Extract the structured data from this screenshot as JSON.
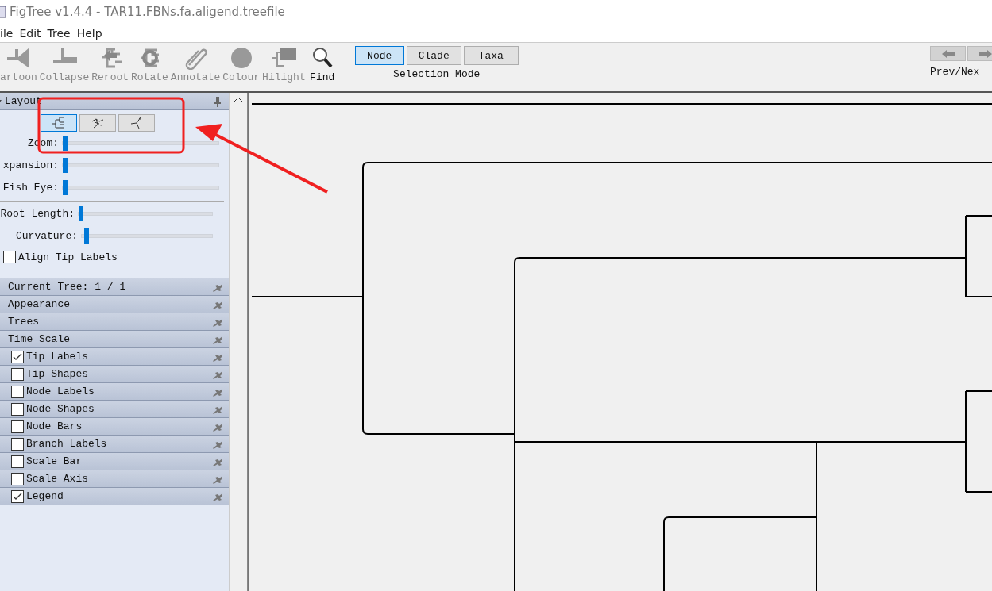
{
  "window": {
    "title": "FigTree v1.4.4 - TAR11.FBNs.fa.aligend.treefile"
  },
  "menu": [
    "ile",
    "Edit",
    "Tree",
    "Help"
  ],
  "toolbar": [
    {
      "label": "artoon",
      "kind": "cartoon"
    },
    {
      "label": "Collapse",
      "kind": "collapse"
    },
    {
      "label": "Reroot",
      "kind": "reroot"
    },
    {
      "label": "Rotate",
      "kind": "rotate"
    },
    {
      "label": "Annotate",
      "kind": "annotate"
    },
    {
      "label": "Colour",
      "kind": "colour"
    },
    {
      "label": "Hilight",
      "kind": "hilight"
    },
    {
      "label": "Find",
      "kind": "find"
    }
  ],
  "selection_mode": {
    "label": "Selection Mode",
    "options": [
      {
        "label": "Node",
        "selected": true
      },
      {
        "label": "Clade",
        "selected": false
      },
      {
        "label": "Taxa",
        "selected": false
      }
    ]
  },
  "prev_next": {
    "label": "Prev/Nex"
  },
  "layout_panel": {
    "title": "Layout",
    "layouts": [
      {
        "kind": "rectangle",
        "selected": true
      },
      {
        "kind": "polar",
        "selected": false
      },
      {
        "kind": "radial",
        "selected": false
      }
    ],
    "sliders": [
      {
        "label": "Zoom:",
        "level": 0
      },
      {
        "label": "xpansion:",
        "level": 0
      },
      {
        "label": "Fish Eye:",
        "level": 0
      }
    ],
    "tree_sliders": [
      {
        "label": "Root Length:",
        "level": 0
      },
      {
        "label": "Curvature:",
        "level": 0.02
      }
    ],
    "align_tip_labels": {
      "label": "Align Tip Labels",
      "checked": false
    }
  },
  "sections": [
    {
      "label": "Current Tree: 1 / 1",
      "kind": "plain"
    },
    {
      "label": "Appearance",
      "kind": "plain"
    },
    {
      "label": "Trees",
      "kind": "plain"
    },
    {
      "label": "Time Scale",
      "kind": "plain"
    },
    {
      "label": "Tip Labels",
      "kind": "check",
      "checked": true
    },
    {
      "label": "Tip Shapes",
      "kind": "check",
      "checked": false
    },
    {
      "label": "Node Labels",
      "kind": "check",
      "checked": false
    },
    {
      "label": "Node Shapes",
      "kind": "check",
      "checked": false
    },
    {
      "label": "Node Bars",
      "kind": "check",
      "checked": false
    },
    {
      "label": "Branch Labels",
      "kind": "check",
      "checked": false
    },
    {
      "label": "Scale Bar",
      "kind": "check",
      "checked": false
    },
    {
      "label": "Scale Axis",
      "kind": "check",
      "checked": false
    },
    {
      "label": "Legend",
      "kind": "check",
      "checked": true
    }
  ]
}
